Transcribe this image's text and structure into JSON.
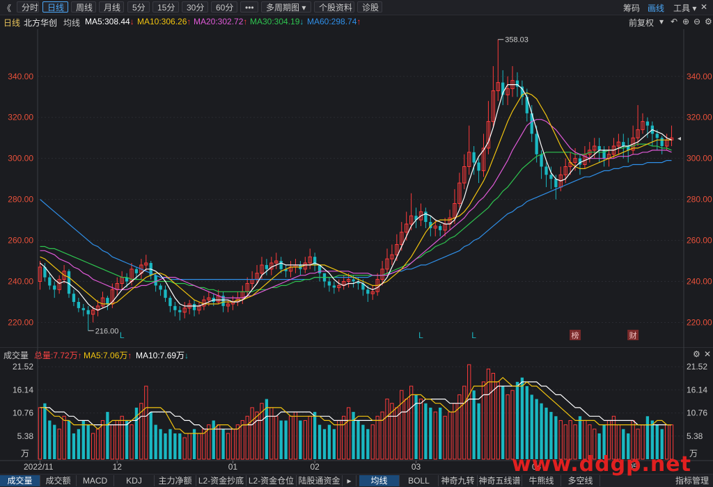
{
  "toolbar": {
    "back": "《",
    "items": [
      "分时",
      "日线",
      "周线",
      "月线",
      "5分",
      "15分",
      "30分",
      "60分",
      "•••",
      "多周期图 ▾",
      "个股资料",
      "诊股"
    ],
    "active": "日线",
    "right": [
      "筹码",
      "画线",
      "工具 ▾"
    ]
  },
  "info": {
    "period": "日线",
    "name": "北方华创",
    "line": "均线",
    "ma5": "MA5:308.44",
    "ma10": "MA10:306.26",
    "ma20": "MA20:302.72",
    "ma30": "MA30:304.19",
    "ma60": "MA60:298.74",
    "adjust": "前复权"
  },
  "volume_info": {
    "label": "成交量",
    "total": "总量:7.72万",
    "ma5": "MA5:7.06万",
    "ma10": "MA10:7.69万"
  },
  "bottom_tabs": [
    "成交量",
    "成交额",
    "MACD",
    "KDJ",
    "主力净额",
    "L2-资金抄底",
    "L2-资金仓位",
    "陆股通资金",
    "均线",
    "BOLL",
    "神奇九转",
    "神奇五线谱",
    "牛熊线",
    "多空线",
    "指标管理"
  ],
  "bottom_active": [
    "成交量",
    "均线"
  ],
  "watermark": "www.ddgp.net",
  "colors": {
    "up": "#ff3b3b",
    "down": "#1ab8c2",
    "ma5": "#ffffff",
    "ma10": "#f2c40f",
    "ma20": "#e05ad8",
    "ma30": "#2ec44f",
    "ma60": "#2f8fe8",
    "background": "#1b1c20"
  },
  "chart_data": {
    "type": "candlestick",
    "price_axis": {
      "ticks": [
        340,
        320,
        300,
        280,
        260,
        240,
        220
      ],
      "labels": [
        "340.00",
        "320.00",
        "300.00",
        "280.00",
        "260.00",
        "240.00",
        "220.00"
      ],
      "range": [
        211,
        363
      ]
    },
    "volume_axis": {
      "ticks": [
        21.52,
        16.14,
        10.76,
        5.38
      ],
      "labels": [
        "21.52",
        "16.14",
        "10.76",
        "5.38"
      ],
      "unit": "万",
      "range": [
        0,
        23
      ]
    },
    "x_labels": [
      "2022/11",
      "12",
      "01",
      "02",
      "03",
      "04",
      "05",
      "06"
    ],
    "x_label_index": [
      0,
      16,
      40,
      57,
      78,
      103,
      123,
      147
    ],
    "annotations": {
      "high": "358.03",
      "low": "216.00",
      "markers": [
        "L",
        "L",
        "L",
        "榜",
        "财"
      ],
      "marker_index": [
        17,
        79,
        90,
        111,
        123
      ]
    },
    "close": [
      247,
      242,
      238,
      236,
      241,
      245,
      234,
      230,
      227,
      226,
      224,
      226,
      228,
      232,
      229,
      236,
      239,
      242,
      240,
      246,
      244,
      248,
      249,
      243,
      238,
      236,
      232,
      228,
      226,
      225,
      227,
      229,
      226,
      228,
      231,
      232,
      230,
      233,
      228,
      229,
      230,
      232,
      235,
      239,
      241,
      244,
      248,
      246,
      249,
      250,
      246,
      245,
      247,
      248,
      246,
      249,
      252,
      248,
      244,
      240,
      238,
      237,
      238,
      240,
      241,
      240,
      239,
      236,
      234,
      235,
      241,
      246,
      251,
      253,
      258,
      264,
      268,
      272,
      270,
      274,
      269,
      266,
      267,
      265,
      268,
      271,
      278,
      288,
      296,
      303,
      298,
      294,
      305,
      318,
      333,
      337,
      331,
      334,
      338,
      335,
      330,
      322,
      312,
      302,
      296,
      292,
      290,
      286,
      292,
      296,
      298,
      300,
      297,
      302,
      304,
      306,
      304,
      300,
      302,
      306,
      308,
      306,
      304,
      310,
      314,
      318,
      316,
      312,
      310,
      306,
      309,
      310
    ],
    "open": [
      240,
      247,
      242,
      238,
      236,
      241,
      245,
      234,
      230,
      227,
      226,
      224,
      226,
      228,
      232,
      229,
      236,
      239,
      242,
      240,
      246,
      244,
      248,
      249,
      243,
      238,
      236,
      232,
      228,
      226,
      225,
      227,
      229,
      226,
      228,
      231,
      232,
      230,
      233,
      228,
      229,
      230,
      232,
      235,
      239,
      241,
      244,
      248,
      246,
      249,
      250,
      246,
      245,
      247,
      248,
      246,
      249,
      252,
      248,
      244,
      240,
      238,
      237,
      238,
      240,
      241,
      240,
      239,
      236,
      234,
      235,
      241,
      246,
      251,
      253,
      258,
      264,
      268,
      272,
      270,
      274,
      269,
      266,
      267,
      265,
      268,
      271,
      278,
      288,
      296,
      303,
      298,
      294,
      305,
      318,
      333,
      337,
      331,
      334,
      338,
      335,
      330,
      322,
      312,
      302,
      296,
      292,
      290,
      286,
      292,
      296,
      298,
      300,
      297,
      302,
      304,
      306,
      304,
      300,
      302,
      306,
      308,
      306,
      304,
      310,
      314,
      318,
      316,
      312,
      310,
      306,
      309
    ],
    "high": [
      250,
      249,
      244,
      240,
      243,
      248,
      246,
      236,
      232,
      229,
      228,
      228,
      231,
      235,
      233,
      239,
      242,
      245,
      244,
      249,
      247,
      251,
      253,
      250,
      244,
      239,
      238,
      233,
      230,
      228,
      230,
      231,
      231,
      230,
      233,
      235,
      234,
      236,
      235,
      231,
      233,
      235,
      238,
      242,
      245,
      248,
      252,
      251,
      252,
      254,
      252,
      248,
      250,
      251,
      250,
      252,
      256,
      254,
      248,
      244,
      242,
      240,
      241,
      243,
      244,
      243,
      242,
      241,
      238,
      238,
      244,
      250,
      256,
      258,
      263,
      269,
      274,
      283,
      276,
      278,
      276,
      272,
      270,
      268,
      271,
      275,
      285,
      293,
      302,
      316,
      306,
      300,
      312,
      328,
      345,
      358,
      343,
      340,
      345,
      342,
      338,
      334,
      326,
      316,
      304,
      298,
      296,
      292,
      296,
      300,
      303,
      305,
      302,
      306,
      308,
      310,
      310,
      306,
      306,
      310,
      312,
      312,
      310,
      316,
      326,
      322,
      320,
      318,
      314,
      311,
      312,
      316
    ],
    "low": [
      236,
      240,
      236,
      232,
      234,
      239,
      232,
      228,
      225,
      223,
      216,
      220,
      223,
      227,
      226,
      227,
      233,
      236,
      237,
      238,
      241,
      241,
      245,
      241,
      235,
      233,
      230,
      225,
      223,
      221,
      222,
      224,
      223,
      224,
      226,
      228,
      228,
      229,
      225,
      225,
      226,
      228,
      229,
      232,
      236,
      239,
      241,
      243,
      243,
      246,
      244,
      242,
      242,
      244,
      243,
      244,
      246,
      245,
      240,
      237,
      235,
      234,
      235,
      236,
      237,
      237,
      236,
      233,
      230,
      231,
      233,
      238,
      243,
      248,
      250,
      255,
      260,
      265,
      266,
      267,
      266,
      262,
      262,
      262,
      262,
      265,
      268,
      276,
      285,
      292,
      292,
      288,
      291,
      302,
      315,
      328,
      326,
      326,
      330,
      330,
      326,
      318,
      308,
      298,
      290,
      286,
      285,
      280,
      284,
      288,
      292,
      294,
      292,
      295,
      298,
      300,
      298,
      296,
      296,
      300,
      302,
      300,
      298,
      302,
      306,
      312,
      310,
      306,
      304,
      302,
      304,
      306
    ],
    "volume": [
      12,
      13,
      9,
      8,
      7,
      10,
      9,
      6,
      7,
      9,
      8,
      6,
      7,
      9,
      11,
      8,
      9,
      10,
      9,
      8,
      12,
      13,
      17,
      11,
      8,
      7,
      6,
      7,
      6,
      6,
      5,
      6,
      7,
      6,
      7,
      8,
      9,
      8,
      7,
      6,
      7,
      8,
      9,
      10,
      12,
      11,
      13,
      14,
      12,
      10,
      9,
      9,
      10,
      11,
      9,
      9,
      10,
      11,
      8,
      7,
      8,
      7,
      9,
      10,
      12,
      11,
      9,
      8,
      7,
      8,
      10,
      11,
      14,
      13,
      12,
      16,
      14,
      17,
      15,
      14,
      13,
      12,
      11,
      12,
      10,
      11,
      13,
      15,
      17,
      22,
      16,
      13,
      18,
      21,
      20,
      18,
      17,
      15,
      16,
      18,
      19,
      17,
      15,
      14,
      13,
      12,
      11,
      10,
      9,
      8,
      9,
      8,
      10,
      9,
      8,
      7,
      6,
      8,
      9,
      10,
      8,
      7,
      6,
      9,
      7,
      8,
      10,
      9,
      8,
      7,
      8,
      8
    ],
    "ma5": [
      249,
      247,
      244,
      241,
      239,
      240,
      239,
      237,
      235,
      232,
      229,
      227,
      226,
      227,
      228,
      230,
      233,
      236,
      238,
      240,
      242,
      244,
      246,
      246,
      245,
      243,
      240,
      236,
      232,
      229,
      228,
      228,
      228,
      228,
      229,
      230,
      231,
      231,
      231,
      231,
      230,
      230,
      231,
      233,
      236,
      239,
      243,
      245,
      247,
      248,
      249,
      248,
      248,
      248,
      248,
      248,
      248,
      249,
      248,
      246,
      244,
      241,
      239,
      238,
      239,
      239,
      240,
      239,
      237,
      236,
      237,
      239,
      242,
      247,
      252,
      257,
      262,
      267,
      270,
      272,
      273,
      272,
      270,
      269,
      268,
      268,
      270,
      275,
      281,
      289,
      296,
      301,
      304,
      308,
      315,
      324,
      332,
      336,
      336,
      336,
      334,
      330,
      322,
      314,
      306,
      299,
      293,
      290,
      289,
      290,
      293,
      296,
      298,
      299,
      300,
      302,
      304,
      304,
      304,
      304,
      305,
      306,
      306,
      307,
      308,
      310,
      312,
      314,
      313,
      312,
      310,
      309
    ],
    "ma10": [
      252,
      251,
      249,
      247,
      245,
      243,
      242,
      240,
      238,
      236,
      234,
      232,
      230,
      229,
      229,
      229,
      230,
      232,
      234,
      236,
      238,
      240,
      242,
      243,
      244,
      244,
      243,
      241,
      239,
      237,
      235,
      233,
      231,
      230,
      229,
      229,
      229,
      229,
      230,
      230,
      230,
      231,
      231,
      232,
      233,
      235,
      237,
      239,
      241,
      243,
      245,
      246,
      247,
      247,
      247,
      248,
      248,
      248,
      248,
      248,
      247,
      246,
      245,
      244,
      243,
      242,
      241,
      240,
      239,
      238,
      238,
      239,
      240,
      242,
      244,
      246,
      249,
      252,
      256,
      260,
      264,
      267,
      269,
      270,
      270,
      270,
      271,
      272,
      274,
      277,
      281,
      285,
      289,
      294,
      300,
      306,
      312,
      318,
      323,
      327,
      331,
      332,
      331,
      329,
      325,
      321,
      316,
      311,
      306,
      302,
      298,
      296,
      295,
      295,
      296,
      297,
      298,
      299,
      300,
      301,
      302,
      303,
      304,
      305,
      305,
      306,
      307,
      308,
      309,
      309,
      309,
      309
    ],
    "ma20": [
      255,
      255,
      254,
      253,
      251,
      250,
      249,
      247,
      246,
      244,
      243,
      241,
      240,
      239,
      238,
      237,
      236,
      236,
      236,
      237,
      237,
      238,
      238,
      239,
      240,
      241,
      242,
      242,
      242,
      241,
      240,
      239,
      238,
      237,
      236,
      235,
      234,
      233,
      232,
      232,
      232,
      232,
      232,
      233,
      233,
      234,
      235,
      236,
      237,
      238,
      239,
      240,
      241,
      242,
      243,
      243,
      244,
      244,
      245,
      245,
      245,
      245,
      245,
      245,
      245,
      244,
      244,
      244,
      244,
      243,
      243,
      243,
      243,
      244,
      245,
      246,
      247,
      249,
      251,
      253,
      255,
      257,
      259,
      261,
      263,
      265,
      267,
      269,
      271,
      274,
      276,
      279,
      281,
      284,
      287,
      291,
      295,
      299,
      304,
      308,
      312,
      316,
      318,
      319,
      319,
      318,
      316,
      314,
      311,
      308,
      305,
      303,
      302,
      301,
      300,
      300,
      300,
      300,
      300,
      300,
      301,
      301,
      301,
      302,
      302,
      303,
      303,
      304,
      304,
      304,
      304,
      303
    ],
    "ma30": [
      257,
      257,
      256,
      256,
      255,
      254,
      253,
      252,
      251,
      250,
      249,
      248,
      247,
      246,
      245,
      244,
      243,
      242,
      242,
      241,
      241,
      241,
      240,
      240,
      240,
      240,
      240,
      240,
      239,
      239,
      239,
      238,
      238,
      237,
      237,
      236,
      236,
      235,
      235,
      235,
      235,
      235,
      235,
      235,
      235,
      236,
      236,
      236,
      237,
      237,
      238,
      238,
      239,
      240,
      240,
      241,
      241,
      242,
      242,
      242,
      242,
      242,
      243,
      243,
      243,
      243,
      243,
      243,
      243,
      243,
      243,
      243,
      244,
      245,
      246,
      247,
      248,
      249,
      251,
      252,
      254,
      255,
      257,
      258,
      259,
      261,
      262,
      264,
      266,
      268,
      270,
      272,
      274,
      276,
      279,
      281,
      284,
      286,
      289,
      292,
      295,
      297,
      299,
      301,
      302,
      303,
      303,
      303,
      303,
      303,
      303,
      302,
      302,
      302,
      303,
      303,
      303,
      303,
      304,
      304,
      305,
      305,
      306,
      306,
      307,
      307,
      307,
      306,
      306,
      305,
      305,
      304
    ],
    "ma60": [
      280,
      278,
      276,
      274,
      272,
      270,
      268,
      266,
      264,
      262,
      260,
      258,
      257,
      255,
      254,
      252,
      251,
      250,
      249,
      248,
      247,
      246,
      245,
      244,
      243,
      242,
      242,
      241,
      241,
      241,
      241,
      241,
      241,
      241,
      241,
      241,
      241,
      241,
      241,
      241,
      241,
      241,
      241,
      241,
      241,
      241,
      241,
      241,
      241,
      241,
      241,
      241,
      241,
      241,
      241,
      241,
      241,
      242,
      242,
      242,
      242,
      242,
      242,
      242,
      242,
      242,
      242,
      242,
      242,
      243,
      243,
      243,
      244,
      244,
      245,
      245,
      246,
      246,
      247,
      248,
      248,
      249,
      250,
      251,
      252,
      253,
      254,
      255,
      257,
      258,
      260,
      261,
      263,
      265,
      267,
      269,
      271,
      273,
      274,
      276,
      277,
      279,
      280,
      281,
      282,
      283,
      284,
      285,
      286,
      287,
      288,
      289,
      290,
      291,
      291,
      292,
      293,
      294,
      294,
      295,
      295,
      296,
      296,
      297,
      297,
      297,
      298,
      298,
      298,
      298,
      299,
      299
    ],
    "vol_ma5": [
      12,
      12,
      11,
      10,
      10,
      9,
      9,
      8,
      8,
      8,
      8,
      8,
      7,
      8,
      8,
      9,
      9,
      9,
      9,
      9,
      10,
      11,
      12,
      12,
      12,
      12,
      11,
      9,
      7,
      7,
      6,
      6,
      6,
      6,
      6,
      7,
      7,
      8,
      8,
      8,
      7,
      7,
      8,
      8,
      9,
      10,
      11,
      12,
      12,
      12,
      12,
      11,
      10,
      10,
      10,
      10,
      10,
      10,
      10,
      9,
      9,
      8,
      8,
      8,
      9,
      9,
      10,
      10,
      10,
      9,
      9,
      9,
      10,
      11,
      12,
      13,
      14,
      15,
      15,
      15,
      14,
      14,
      13,
      13,
      12,
      11,
      11,
      12,
      13,
      15,
      17,
      17,
      17,
      18,
      18,
      18,
      19,
      18,
      17,
      17,
      17,
      18,
      17,
      17,
      16,
      15,
      14,
      13,
      12,
      11,
      10,
      9,
      9,
      9,
      9,
      9,
      8,
      8,
      8,
      8,
      8,
      8,
      8,
      8,
      8,
      8,
      8,
      8,
      9,
      9,
      8,
      8
    ],
    "vol_ma10": [
      12,
      12,
      12,
      11,
      11,
      11,
      10,
      10,
      9,
      9,
      9,
      8,
      8,
      8,
      8,
      8,
      8,
      8,
      8,
      9,
      9,
      10,
      10,
      11,
      11,
      11,
      11,
      11,
      10,
      10,
      9,
      9,
      8,
      8,
      7,
      7,
      7,
      7,
      7,
      7,
      7,
      7,
      8,
      8,
      8,
      9,
      9,
      10,
      10,
      10,
      11,
      11,
      11,
      11,
      11,
      11,
      11,
      10,
      10,
      10,
      10,
      9,
      9,
      9,
      9,
      9,
      9,
      9,
      9,
      9,
      9,
      9,
      10,
      10,
      10,
      11,
      11,
      12,
      13,
      13,
      14,
      14,
      14,
      14,
      14,
      13,
      13,
      13,
      13,
      14,
      14,
      14,
      15,
      15,
      16,
      17,
      17,
      17,
      17,
      17,
      18,
      18,
      18,
      18,
      17,
      17,
      16,
      15,
      15,
      14,
      13,
      12,
      12,
      11,
      10,
      10,
      10,
      9,
      9,
      9,
      9,
      9,
      9,
      9,
      8,
      8,
      8,
      8,
      8,
      8,
      8,
      8
    ]
  }
}
